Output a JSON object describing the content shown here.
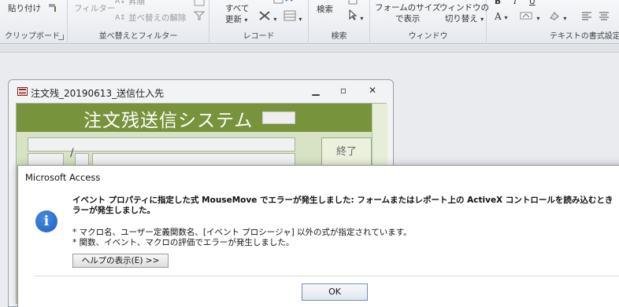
{
  "ribbon": {
    "clipboard": {
      "paste": "貼り付け",
      "label": "クリップボード"
    },
    "sort_filter": {
      "filter": "フィルター",
      "asc": "昇順",
      "clear_sort": "並べ替えの解除",
      "label": "並べ替えとフィルター"
    },
    "records": {
      "refresh_all_line1": "すべて",
      "refresh_all_line2": "更新",
      "label": "レコード"
    },
    "find": {
      "find": "検索",
      "label": "検索"
    },
    "window": {
      "fit_form_line1": "フォームのサイズ",
      "fit_form_line2": "で表示",
      "switch_line1": "ウィンドウの",
      "switch_line2": "切り替え",
      "label": "ウィンドウ"
    },
    "text_format": {
      "font_a": "A",
      "label": "テキストの書式設定"
    }
  },
  "form_window": {
    "title": "注文残_20190613_送信仕入先",
    "header_title": "注文残送信システム",
    "end_button": "終了",
    "slash": "/"
  },
  "dialog": {
    "title": "Microsoft Access",
    "main_line1": "イベント プロパティに指定した式 MouseMove でエラーが発生しました: フォームまたはレポート上の ActiveX コントロールを読み込むとき",
    "main_line2": "ラーが発生しました。",
    "sub_line1": "* マクロ名、ユーザー定義関数名、[イベント プロシージャ] 以外の式が指定されています。",
    "sub_line2": "* 関数、イベント、マクロの評価でエラーが発生しました。",
    "help_button": "ヘルプの表示(E) >>",
    "ok_button": "OK",
    "info_icon": "i"
  },
  "colors": {
    "form_header": "#77933c",
    "form_background": "#d7e3c4",
    "info_icon": "#1b5fc0"
  }
}
